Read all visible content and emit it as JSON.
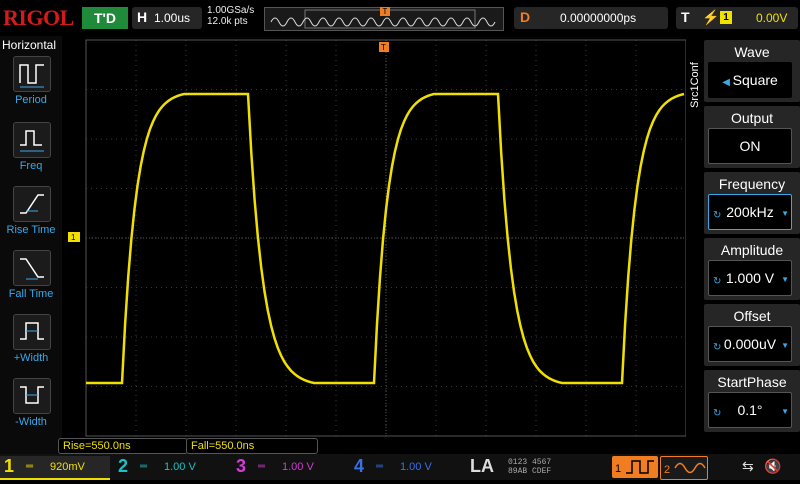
{
  "header": {
    "logo_red": "RIGOL",
    "run_state": "T'D",
    "timebase_label": "H",
    "timebase_value": "1.00us",
    "sample_rate": "1.00GSa/s",
    "memory_depth": "12.0k pts",
    "trigger_pos_marker": "T",
    "delay_label": "D",
    "delay_value": "0.00000000ps",
    "trigger_label": "T",
    "trigger_source": "1",
    "trigger_level": "0.00V"
  },
  "left_menu": {
    "title": "Horizontal",
    "items": [
      {
        "label": "Period",
        "icon": "period-icon"
      },
      {
        "label": "Freq",
        "icon": "frequency-icon"
      },
      {
        "label": "Rise Time",
        "icon": "rise-time-icon"
      },
      {
        "label": "Fall Time",
        "icon": "fall-time-icon"
      },
      {
        "label": "+Width",
        "icon": "positive-width-icon"
      },
      {
        "label": "-Width",
        "icon": "negative-width-icon"
      }
    ]
  },
  "right_menu": {
    "vertical_title": "Src1Conf",
    "items": [
      {
        "title": "Wave",
        "value": "Square"
      },
      {
        "title": "Output",
        "value": "ON"
      },
      {
        "title": "Frequency",
        "value": "200kHz"
      },
      {
        "title": "Amplitude",
        "value": "1.000 V"
      },
      {
        "title": "Offset",
        "value": "0.000uV"
      },
      {
        "title": "StartPhase",
        "value": "0.1°"
      }
    ]
  },
  "measurements": {
    "rise": "Rise=550.0ns",
    "fall": "Fall=550.0ns"
  },
  "channels": [
    {
      "num": "1",
      "coupling": "═",
      "scale": "920mV",
      "color": "#f0e000",
      "active": true
    },
    {
      "num": "2",
      "coupling": "═",
      "scale": "1.00 V",
      "color": "#19c3c3",
      "active": false
    },
    {
      "num": "3",
      "coupling": "═",
      "scale": "1.00 V",
      "color": "#d23cd2",
      "active": false
    },
    {
      "num": "4",
      "coupling": "═",
      "scale": "1.00 V",
      "color": "#3b6fe8",
      "active": false
    }
  ],
  "bottom": {
    "la_label": "LA",
    "la_row1": "0123 4567",
    "la_row2": "89AB CDEF",
    "gen1": "1",
    "gen2": "2"
  },
  "colors": {
    "ch1": "#f0e000",
    "accent": "#3ba7e8",
    "trigger": "#f07d22"
  }
}
